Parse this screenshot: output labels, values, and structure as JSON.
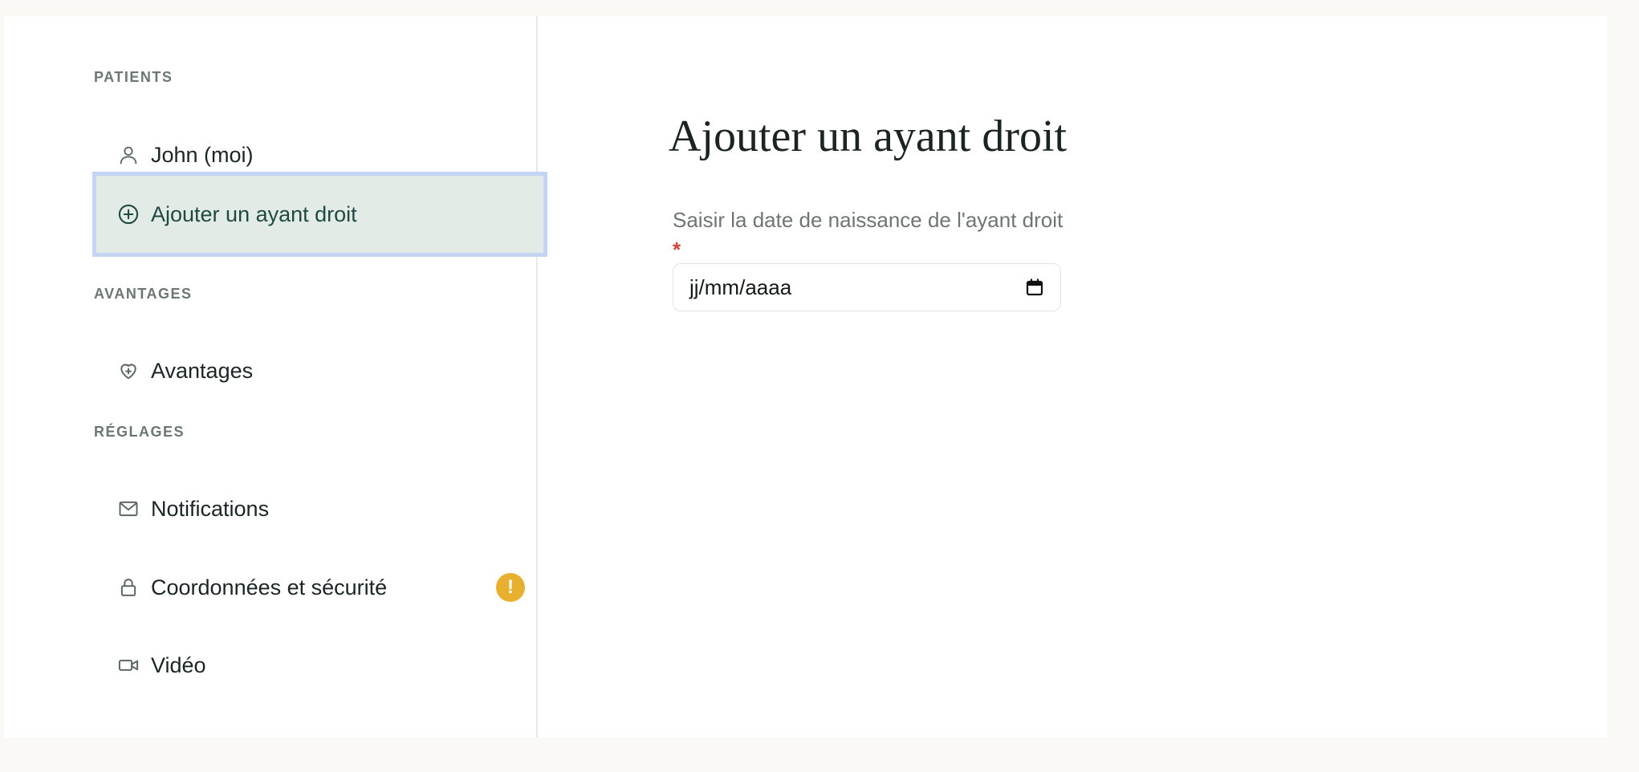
{
  "sidebar": {
    "sections": {
      "patients": "PATIENTS",
      "avantages": "AVANTAGES",
      "reglages": "RÉGLAGES"
    },
    "items": {
      "john": {
        "label": "John (moi)",
        "icon": "user-icon"
      },
      "add_dependent": {
        "label": "Ajouter un ayant droit",
        "icon": "plus-circle-icon",
        "active": true
      },
      "benefits": {
        "label": "Avantages",
        "icon": "heart-plus-icon"
      },
      "notifications": {
        "label": "Notifications",
        "icon": "mail-icon"
      },
      "security": {
        "label": "Coordonnées et sécurité",
        "icon": "lock-icon",
        "badge": "!"
      },
      "video": {
        "label": "Vidéo",
        "icon": "video-icon"
      }
    }
  },
  "main": {
    "title": "Ajouter un ayant droit",
    "field": {
      "label": "Saisir la date de naissance de l'ayant droit",
      "required_mark": "*",
      "placeholder": "jj/mm/aaaa"
    }
  },
  "colors": {
    "accent": "#1f4a42",
    "active_bg": "#e3ebe7",
    "focus_ring": "#c5d3f5",
    "warning": "#e9b030",
    "required": "#d0443a"
  }
}
